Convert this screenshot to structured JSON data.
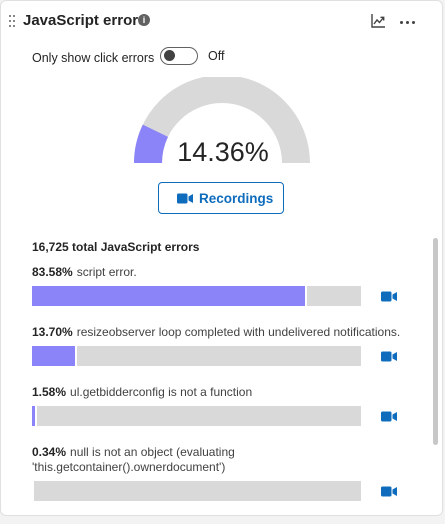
{
  "widget": {
    "title": "JavaScript errors",
    "info_icon": "info-icon",
    "header_icons": [
      "trend-chart-icon",
      "more-horizontal-icon"
    ]
  },
  "filter": {
    "label": "Only show click errors",
    "state_label": "Off",
    "enabled": false
  },
  "gauge": {
    "value_label": "14.36%",
    "value_percent": 14.36,
    "fill_color": "#8a84f8",
    "track_color": "#d9d9d9"
  },
  "recordings_button": {
    "label": "Recordings",
    "icon": "video-camera-icon",
    "color": "#0f6cbd"
  },
  "summary": {
    "total_label": "16,725 total JavaScript errors"
  },
  "errors": [
    {
      "percent_label": "83.58%",
      "message": "script error.",
      "percent": 83.58
    },
    {
      "percent_label": "13.70%",
      "message": "resizeobserver loop completed with undelivered notifications.",
      "percent": 13.7
    },
    {
      "percent_label": "1.58%",
      "message": "ul.getbidderconfig is not a function",
      "percent": 1.58
    },
    {
      "percent_label": "0.34%",
      "message": "null is not an object (evaluating 'this.getcontainer().ownerdocument')",
      "percent": 0.34
    }
  ],
  "colors": {
    "bar_fill": "#8a84f8",
    "bar_track": "#d9d9d9",
    "link_blue": "#0f6cbd"
  }
}
